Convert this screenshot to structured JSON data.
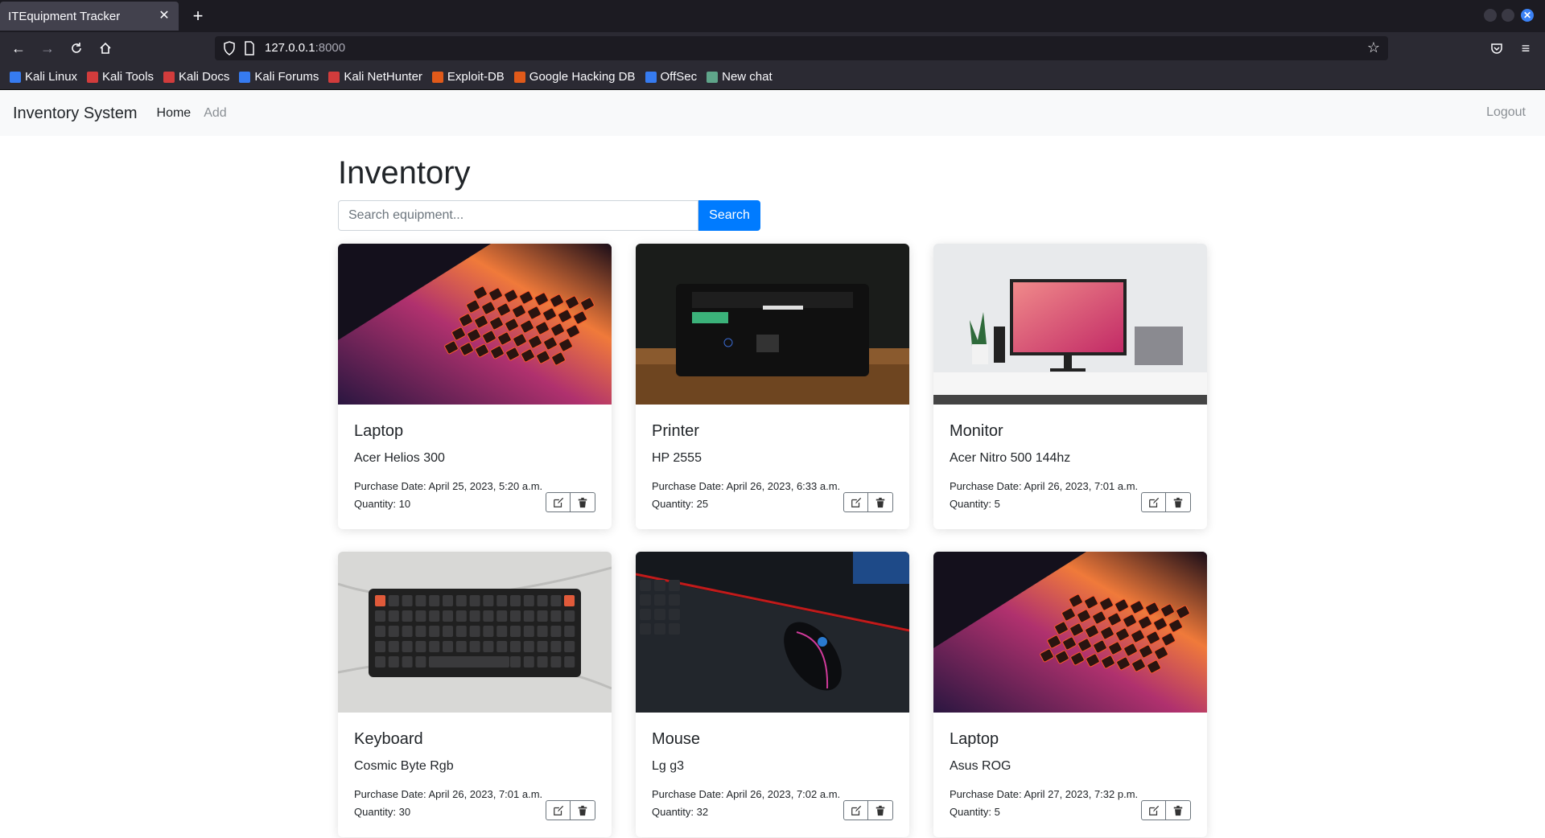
{
  "browser": {
    "tab_title": "ITEquipment Tracker",
    "url_host": "127.0.0.1",
    "url_port": ":8000",
    "bookmarks": [
      {
        "label": "Kali Linux",
        "color": "#367bf0"
      },
      {
        "label": "Kali Tools",
        "color": "#d23c3c"
      },
      {
        "label": "Kali Docs",
        "color": "#d23c3c"
      },
      {
        "label": "Kali Forums",
        "color": "#367bf0"
      },
      {
        "label": "Kali NetHunter",
        "color": "#d23c3c"
      },
      {
        "label": "Exploit-DB",
        "color": "#e05a1a"
      },
      {
        "label": "Google Hacking DB",
        "color": "#e05a1a"
      },
      {
        "label": "OffSec",
        "color": "#367bf0"
      },
      {
        "label": "New chat",
        "color": "#5fa58a"
      }
    ]
  },
  "navbar": {
    "brand": "Inventory System",
    "home": "Home",
    "add": "Add",
    "logout": "Logout"
  },
  "page": {
    "title": "Inventory",
    "search_placeholder": "Search equipment...",
    "search_button": "Search"
  },
  "items": [
    {
      "name": "Laptop",
      "model": "Acer Helios 300",
      "purchase_date": "Purchase Date: April 25, 2023, 5:20 a.m.",
      "quantity": "Quantity: 10",
      "image": "laptop"
    },
    {
      "name": "Printer",
      "model": "HP 2555",
      "purchase_date": "Purchase Date: April 26, 2023, 6:33 a.m.",
      "quantity": "Quantity: 25",
      "image": "printer"
    },
    {
      "name": "Monitor",
      "model": "Acer Nitro 500 144hz",
      "purchase_date": "Purchase Date: April 26, 2023, 7:01 a.m.",
      "quantity": "Quantity: 5",
      "image": "monitor"
    },
    {
      "name": "Keyboard",
      "model": "Cosmic Byte Rgb",
      "purchase_date": "Purchase Date: April 26, 2023, 7:01 a.m.",
      "quantity": "Quantity: 30",
      "image": "keyboard"
    },
    {
      "name": "Mouse",
      "model": "Lg g3",
      "purchase_date": "Purchase Date: April 26, 2023, 7:02 a.m.",
      "quantity": "Quantity: 32",
      "image": "mouse"
    },
    {
      "name": "Laptop",
      "model": "Asus ROG",
      "purchase_date": "Purchase Date: April 27, 2023, 7:32 p.m.",
      "quantity": "Quantity: 5",
      "image": "laptop"
    }
  ],
  "colors": {
    "primary": "#007bff",
    "navbar_bg": "#f8f9fa",
    "chrome_dark": "#1c1b22",
    "chrome_mid": "#2b2a33"
  }
}
